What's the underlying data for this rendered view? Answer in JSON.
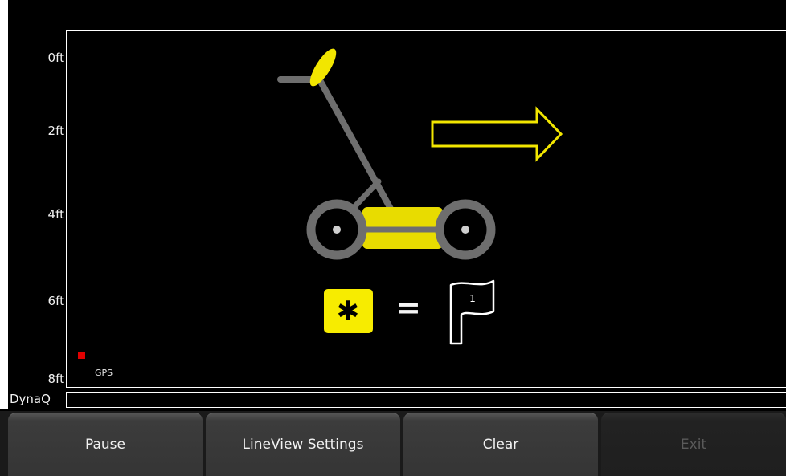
{
  "depth_axis": {
    "labels": [
      "0ft",
      "2ft",
      "4ft",
      "6ft",
      "8ft"
    ]
  },
  "gps": {
    "label": "GPS",
    "status_color": "#e00000"
  },
  "dynaq": {
    "label": "DynaQ"
  },
  "instructions": {
    "direction_icon": "right-arrow-icon",
    "key_glyph": "✱",
    "equals": "=",
    "flag_number": "1",
    "accent_color": "#f2e600"
  },
  "softkeys": [
    {
      "label": "Pause",
      "enabled": true
    },
    {
      "label": "LineView Settings",
      "enabled": true
    },
    {
      "label": "Clear",
      "enabled": true
    },
    {
      "label": "Exit",
      "enabled": false
    }
  ]
}
